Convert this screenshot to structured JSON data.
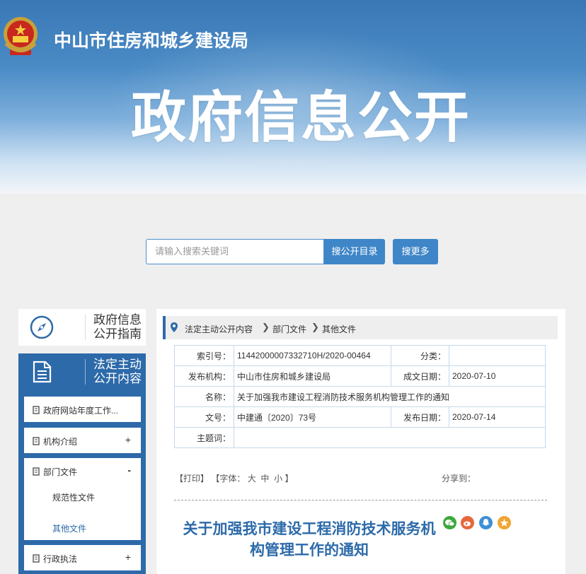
{
  "header": {
    "org_name": "中山市住房和城乡建设局",
    "banner_title": "政府信息公开"
  },
  "search": {
    "placeholder": "请输入搜索关键词",
    "search_catalog_label": "搜公开目录",
    "search_more_label": "搜更多"
  },
  "sidebar": {
    "guide_label": "政府信息公开指南",
    "active_label": "法定主动公开内容",
    "items": [
      {
        "label": "政府网站年度工作...",
        "sign": ""
      },
      {
        "label": "机构介绍",
        "sign": "+"
      },
      {
        "label": "部门文件",
        "sign": "-"
      },
      {
        "label": "行政执法",
        "sign": "+"
      }
    ],
    "sub_items": [
      {
        "label": "规范性文件"
      },
      {
        "label": "其他文件"
      }
    ]
  },
  "breadcrumb": [
    "法定主动公开内容",
    "部门文件",
    "其他文件"
  ],
  "meta": {
    "index_label": "索引号：",
    "index_value": "11442000007332710H/2020-00464",
    "category_label": "分类：",
    "category_value": "",
    "publisher_label": "发布机构：",
    "publisher_value": "中山市住房和城乡建设局",
    "created_label": "成文日期：",
    "created_value": "2020-07-10",
    "name_label": "名称：",
    "name_value": "关于加强我市建设工程消防技术服务机构管理工作的通知",
    "docno_label": "文号：",
    "docno_value": "中建通〔2020〕73号",
    "published_label": "发布日期：",
    "published_value": "2020-07-14",
    "subject_label": "主题词：",
    "subject_value": ""
  },
  "toolbar": {
    "print_label": "【打印】",
    "font_label": "【字体：",
    "font_large": "大",
    "font_medium": "中",
    "font_small": "小",
    "font_end": "】",
    "share_label": "分享到："
  },
  "document": {
    "title": "关于加强我市建设工程消防技术服务机构管理工作的通知"
  },
  "colors": {
    "brand_blue": "#2d6aa9",
    "button_blue": "#3f86c8"
  }
}
